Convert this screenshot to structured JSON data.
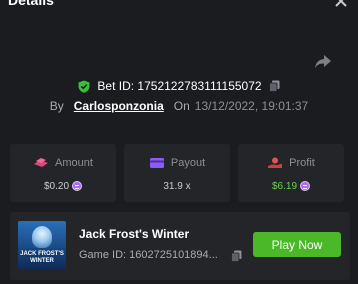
{
  "dialog": {
    "title": "Details",
    "close_icon": "close-icon",
    "share_icon": "share-arrow-icon"
  },
  "bet": {
    "label": "Bet ID: 1752122783111155072",
    "badge_icon": "shield-check-icon",
    "copy_icon": "copy-icon",
    "by_label": "By",
    "username": "Carlosponzonia",
    "on_label": "On",
    "datetime": "13/12/2022, 19:01:37"
  },
  "stats": [
    {
      "label": "Amount",
      "value": "$0.20",
      "icon": "bet-stack-icon",
      "coin": true,
      "color": "#e0457b"
    },
    {
      "label": "Payout",
      "value": "31.9 x",
      "icon": "payout-card-icon",
      "coin": false,
      "color": "#8b5cf6"
    },
    {
      "label": "Profit",
      "value": "$6.19",
      "icon": "profit-hand-icon",
      "coin": true,
      "color": "#e2554f"
    }
  ],
  "game": {
    "title": "Jack Frost's Winter",
    "id_text": "Game ID: 1602725101894...",
    "thumbnail_text": "JACK FROST'S WINTER",
    "play_label": "Play Now"
  },
  "colors": {
    "background": "#1a1c1f",
    "card": "#232529",
    "accent_green": "#4bb82a",
    "profit_green": "#6ad24a"
  }
}
